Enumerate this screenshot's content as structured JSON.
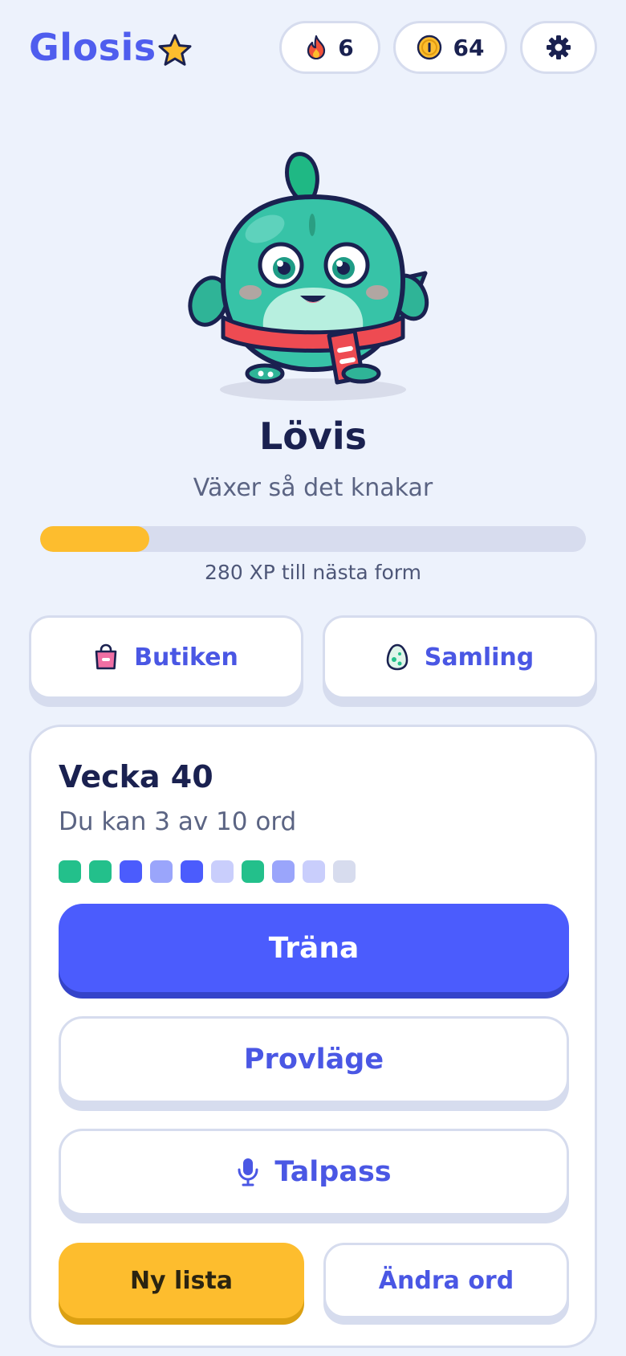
{
  "header": {
    "app_name": "Glosis",
    "logo_icon": "star-icon",
    "streak": {
      "icon": "flame-icon",
      "value": "6"
    },
    "coins": {
      "icon": "coin-icon",
      "value": "64"
    },
    "settings_icon": "gear-icon"
  },
  "pet": {
    "name": "Lövis",
    "status": "Växer så det knakar",
    "xp_progress": 0.2,
    "xp_text": "280 XP till nästa form"
  },
  "actions": {
    "shop": {
      "label": "Butiken",
      "icon": "shopping-bag-icon"
    },
    "collection": {
      "label": "Samling",
      "icon": "egg-icon"
    }
  },
  "week": {
    "title": "Vecka 40",
    "subtitle": "Du kan 3 av 10 ord",
    "word_progress": [
      "learned",
      "learned",
      "practicing",
      "started",
      "practicing",
      "new",
      "learned",
      "started",
      "new",
      "empty"
    ],
    "train_label": "Träna",
    "exam_label": "Provläge",
    "speech_label": "Talpass",
    "speech_icon": "microphone-icon",
    "new_list_label": "Ny lista",
    "edit_words_label": "Ändra ord"
  },
  "colors": {
    "accent": "#4b5cfd",
    "yellow": "#fdbd2e",
    "learned": "#23c08b",
    "practicing": "#4b5cfd",
    "started": "#9aa5fb",
    "new": "#c9cefc",
    "empty": "#d7dcee"
  }
}
